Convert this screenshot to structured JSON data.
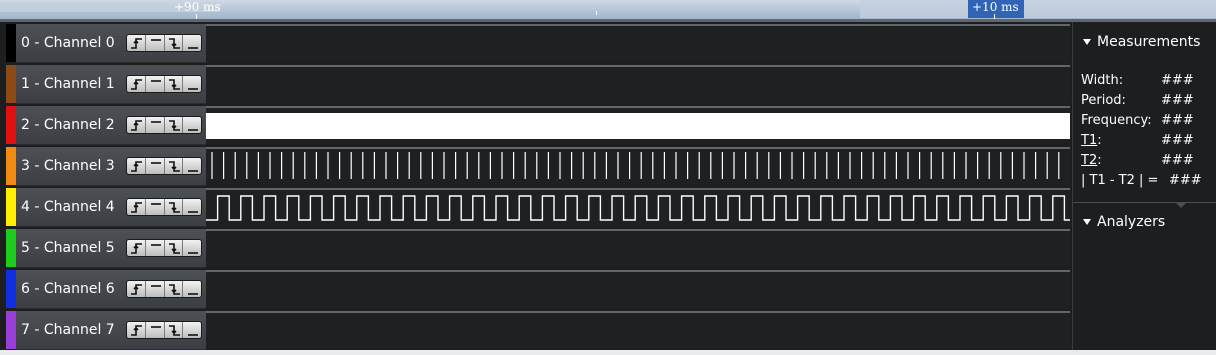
{
  "ruler": {
    "left_label": "+90 ms",
    "right_label": "+10 ms"
  },
  "channels": [
    {
      "name": "0 - Channel 0",
      "color": "#000000",
      "signal": "low"
    },
    {
      "name": "1 - Channel 1",
      "color": "#8b4a16",
      "signal": "low"
    },
    {
      "name": "2 - Channel 2",
      "color": "#e01010",
      "signal": "high"
    },
    {
      "name": "3 - Channel 3",
      "color": "#f08a10",
      "signal": "pulses"
    },
    {
      "name": "4 - Channel 4",
      "color": "#ffee00",
      "signal": "square"
    },
    {
      "name": "5 - Channel 5",
      "color": "#1ecc1e",
      "signal": "low"
    },
    {
      "name": "6 - Channel 6",
      "color": "#1030e0",
      "signal": "low"
    },
    {
      "name": "7 - Channel 7",
      "color": "#9a40d8",
      "signal": "low"
    }
  ],
  "trigger_buttons": [
    "rising-edge-icon",
    "high-level-icon",
    "falling-edge-icon",
    "low-level-icon"
  ],
  "measurements": {
    "title": "Measurements",
    "rows": [
      {
        "label": "Width:",
        "value": "###"
      },
      {
        "label": "Period:",
        "value": "###"
      },
      {
        "label": "Frequency:",
        "value": "###"
      },
      {
        "label": "T1",
        "suffix": ":",
        "value": "###"
      },
      {
        "label": "T2",
        "suffix": ":",
        "value": "###"
      },
      {
        "label": "| T1 - T2 | =",
        "value": "###"
      }
    ]
  },
  "analyzers": {
    "title": "Analyzers"
  }
}
